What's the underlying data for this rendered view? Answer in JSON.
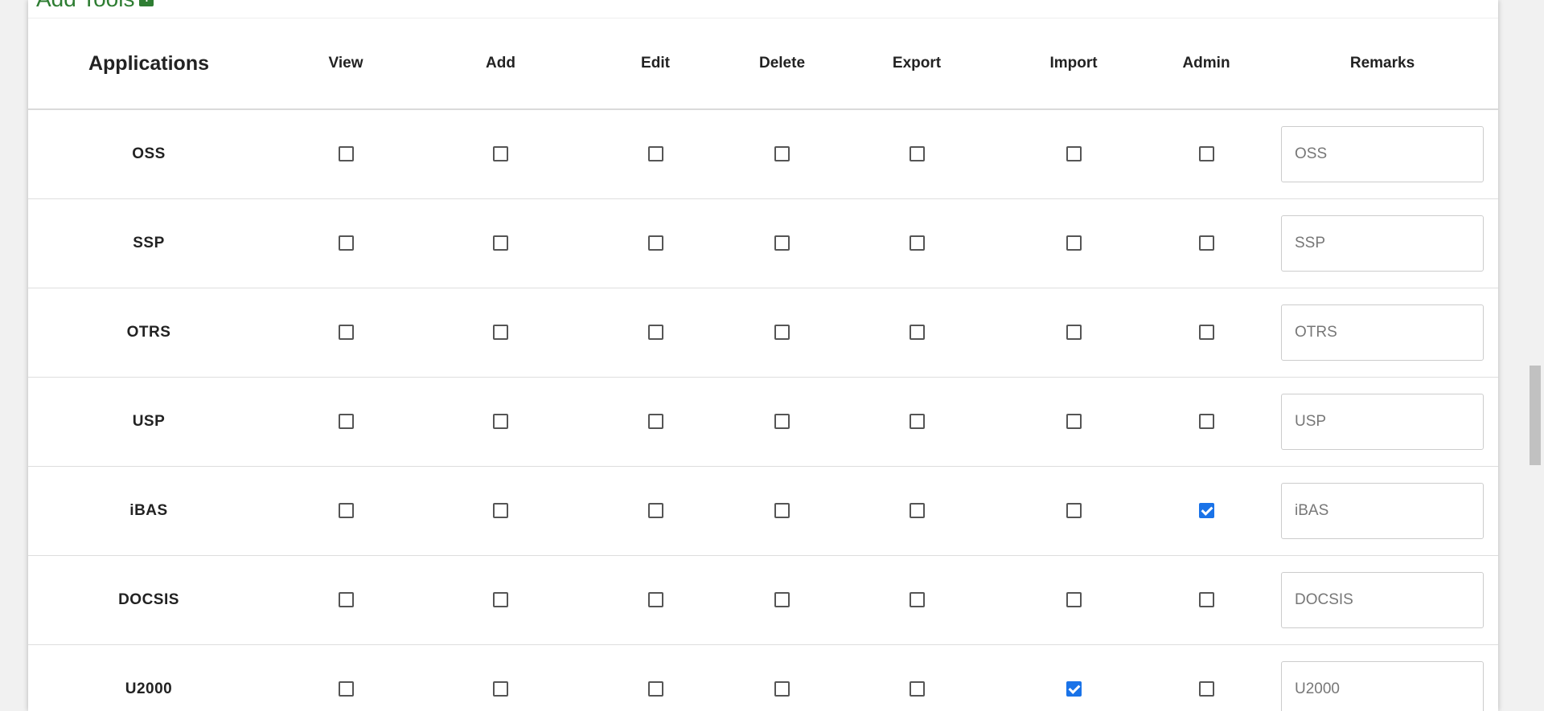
{
  "header": {
    "add_tools_label": "Add Tools",
    "add_icon": "plus-icon"
  },
  "table": {
    "columns": [
      "Applications",
      "View",
      "Add",
      "Edit",
      "Delete",
      "Export",
      "Import",
      "Admin",
      "Remarks"
    ],
    "rows": [
      {
        "name": "OSS",
        "checks": [
          false,
          false,
          false,
          false,
          false,
          false,
          false
        ],
        "remark_placeholder": "OSS"
      },
      {
        "name": "SSP",
        "checks": [
          false,
          false,
          false,
          false,
          false,
          false,
          false
        ],
        "remark_placeholder": "SSP"
      },
      {
        "name": "OTRS",
        "checks": [
          false,
          false,
          false,
          false,
          false,
          false,
          false
        ],
        "remark_placeholder": "OTRS"
      },
      {
        "name": "USP",
        "checks": [
          false,
          false,
          false,
          false,
          false,
          false,
          false
        ],
        "remark_placeholder": "USP"
      },
      {
        "name": "iBAS",
        "checks": [
          false,
          false,
          false,
          false,
          false,
          false,
          true
        ],
        "remark_placeholder": "iBAS"
      },
      {
        "name": "DOCSIS",
        "checks": [
          false,
          false,
          false,
          false,
          false,
          false,
          false
        ],
        "remark_placeholder": "DOCSIS"
      },
      {
        "name": "U2000",
        "checks": [
          false,
          false,
          false,
          false,
          false,
          true,
          false
        ],
        "remark_placeholder": "U2000"
      }
    ]
  },
  "colors": {
    "accent": "#1a73e8",
    "add_tools_green": "#2e7d32"
  }
}
